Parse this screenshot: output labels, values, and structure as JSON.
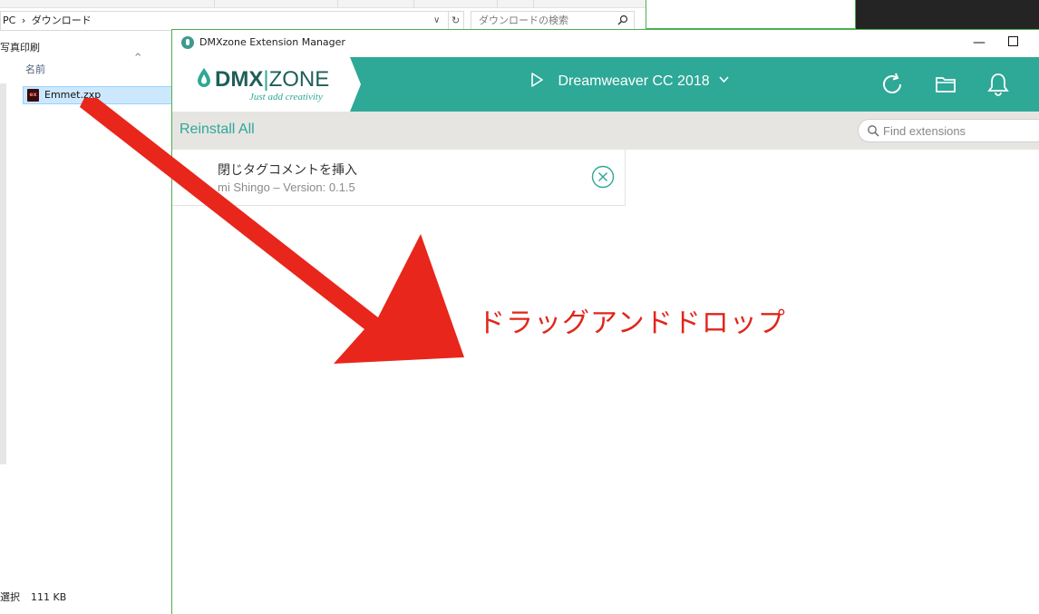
{
  "explorer": {
    "breadcrumb_pc": "PC",
    "breadcrumb_sep": "›",
    "breadcrumb_folder": "ダウンロード",
    "search_placeholder": "ダウンロードの検索",
    "nav_label": "写真印刷",
    "column_name": "名前",
    "file_name": "Emmet.zxp",
    "status_selected": "選択",
    "status_size": "111 KB"
  },
  "window": {
    "title": "DMXzone Extension Manager",
    "minimize_glyph": "—"
  },
  "header": {
    "logo_dmx": "DMX",
    "logo_bar": "|",
    "logo_zone": "ZONE",
    "tagline": "Just add creativity",
    "product": "Dreamweaver CC 2018",
    "product_chevron": "∨",
    "brand_color": "#2ea897"
  },
  "toolbar": {
    "reinstall_label": "Reinstall All",
    "search_placeholder": "Find extensions"
  },
  "extensions": [
    {
      "name": "閉じタグコメントを挿入",
      "meta": "mi Shingo – Version: 0.1.5"
    }
  ],
  "annotation": {
    "text": "ドラッグアンドドロップ",
    "color": "#e0261b"
  },
  "icons": [
    "play-icon",
    "chevron-down-icon",
    "refresh-icon",
    "folder-icon",
    "bell-icon",
    "search-icon",
    "remove-icon"
  ]
}
